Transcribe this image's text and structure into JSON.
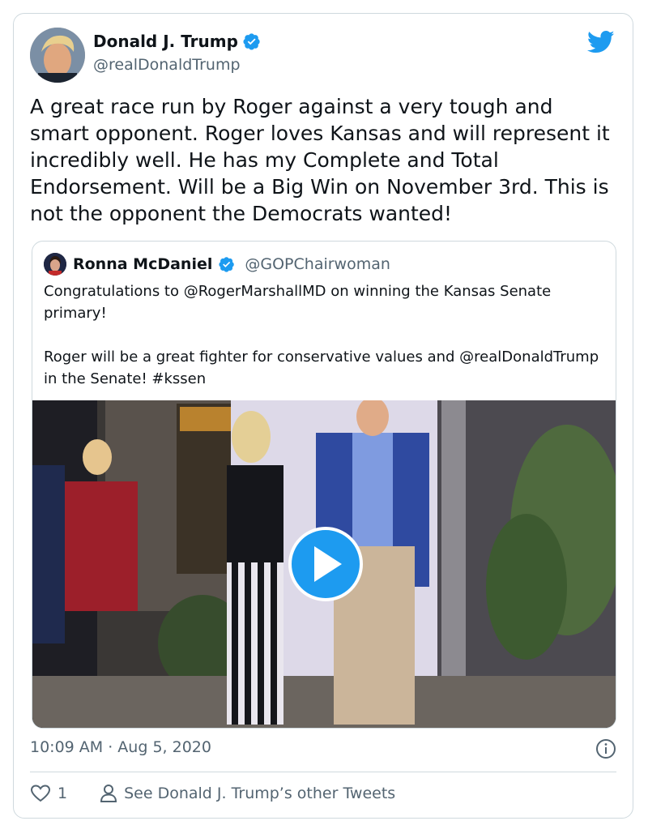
{
  "tweet": {
    "author_name": "Donald J. Trump",
    "author_handle": "@realDonaldTrump",
    "text": "A great race run by Roger against a very tough and smart opponent. Roger loves Kansas and will represent it incredibly well. He has my Complete and Total Endorsement. Will be a Big Win on November 3rd. This is not the opponent the Democrats wanted!",
    "timestamp": "10:09 AM · Aug 5, 2020",
    "likes": "1",
    "see_more_label": "See Donald J. Trump’s other Tweets"
  },
  "quote": {
    "author_name": "Ronna McDaniel",
    "author_handle": "@GOPChairwoman",
    "paragraph1": "Congratulations to @RogerMarshallMD on winning the Kansas Senate primary!",
    "paragraph2": "Roger will be a great fighter for conservative values and @realDonaldTrump in the Senate! #kssen"
  },
  "icons": {
    "verified": "verified-badge-icon",
    "bird": "twitter-bird-icon",
    "play": "play-icon",
    "info": "info-icon",
    "heart": "heart-icon",
    "person": "person-icon"
  },
  "colors": {
    "accent": "#1d9bf0",
    "secondary_text": "#536471",
    "border": "#cfd9de"
  }
}
